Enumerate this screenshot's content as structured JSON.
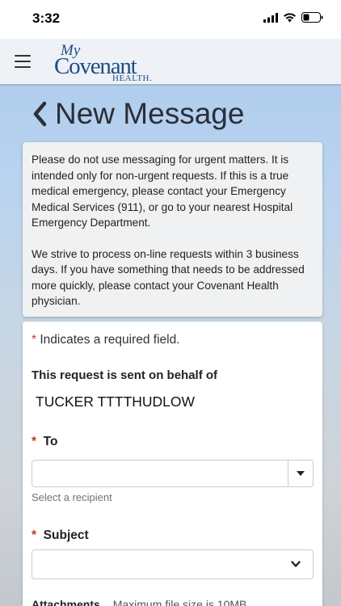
{
  "status_bar": {
    "time": "3:32"
  },
  "header": {
    "logo_my": "My",
    "logo_covenant": "Covenant",
    "logo_health": "HEALTH."
  },
  "page": {
    "title": "New Message"
  },
  "notice": {
    "paragraph1": "Please do not use messaging for urgent matters. It is intended only for non-urgent requests. If this is a true medical emergency, please contact your Emergency Medical Services (911), or go to your nearest Hospital Emergency Department.",
    "paragraph2": "We strive to process on-line requests within 3 business days. If you have something that needs to be addressed more quickly, please contact your Covenant Health physician."
  },
  "form": {
    "required_star": "*",
    "required_note": "Indicates a required field.",
    "behalf_label": "This request is sent on behalf of",
    "behalf_name": "TUCKER TTTTHUDLOW",
    "to_label": "To",
    "to_value": "",
    "to_helper": "Select a recipient",
    "subject_label": "Subject",
    "subject_value": "",
    "attachments_label": "Attachments",
    "attachments_hint": "Maximum file size is 10MB"
  },
  "colors": {
    "brand": "#1f4d86",
    "required": "#c0392b"
  }
}
